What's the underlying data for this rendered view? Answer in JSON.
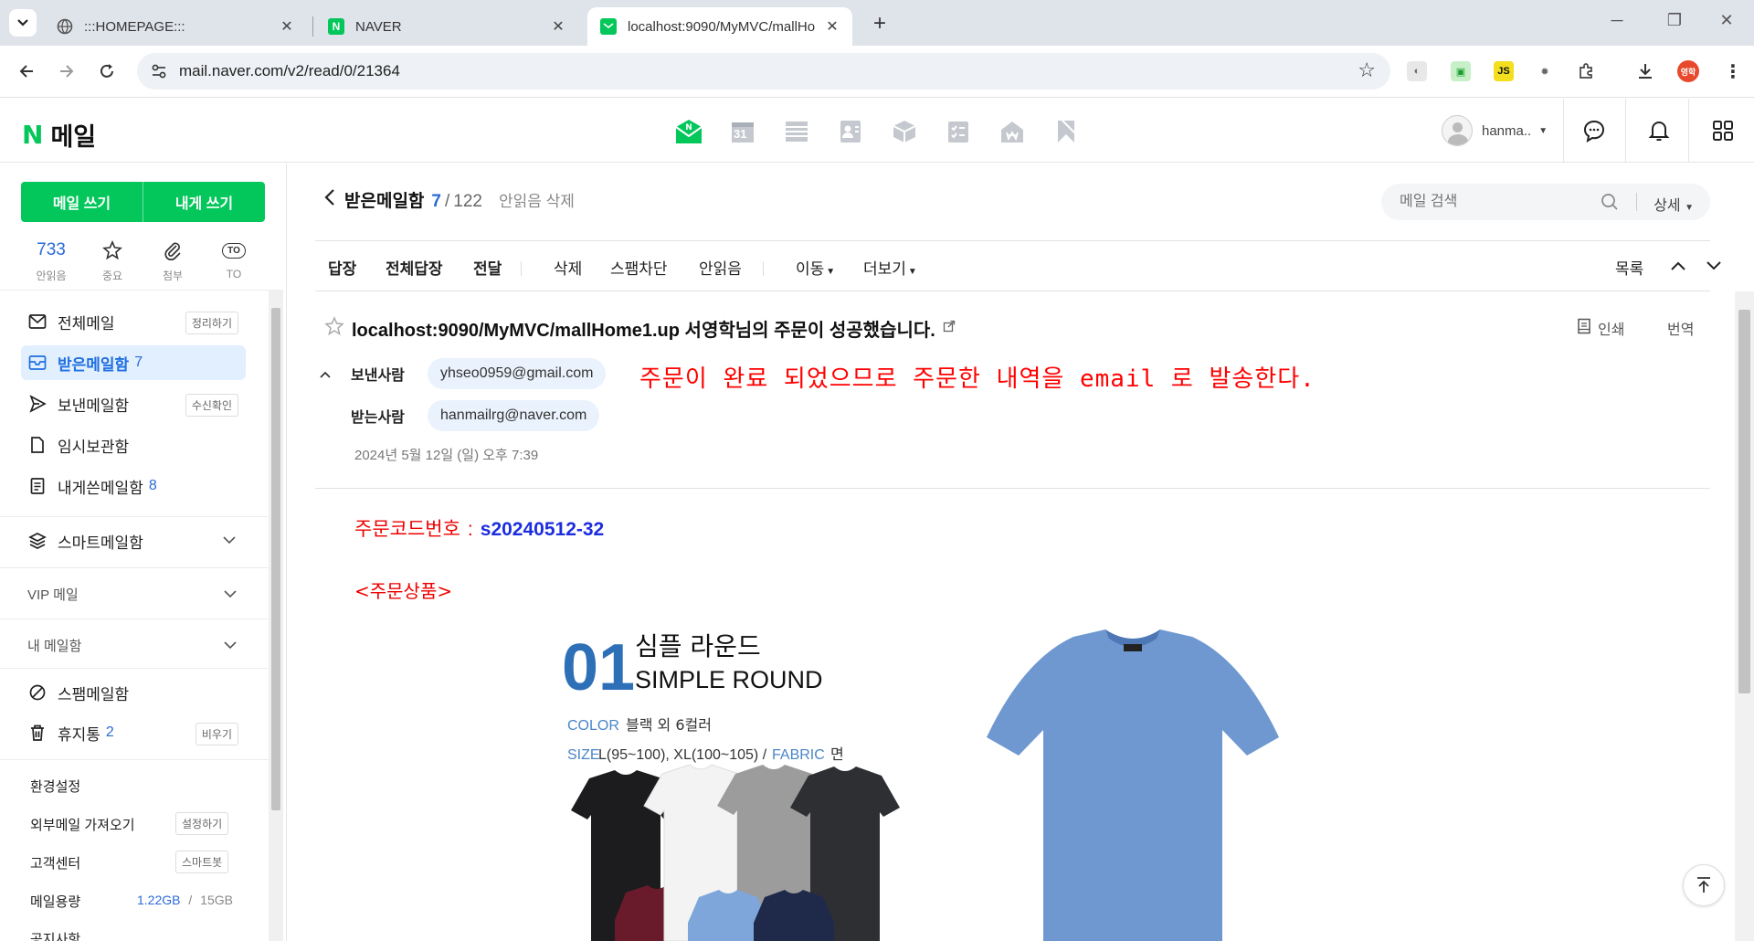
{
  "browser": {
    "tabs": [
      {
        "title": ":::HOMEPAGE:::",
        "icon": "globe-icon"
      },
      {
        "title": "NAVER",
        "icon": "naver-n-icon"
      },
      {
        "title": "localhost:9090/MyMVC/mallHo",
        "icon": "naver-mail-icon"
      }
    ],
    "url": "mail.naver.com/v2/read/0/21364",
    "profile_badge": "영학",
    "ext_js": "JS"
  },
  "app": {
    "logo_letter": "N",
    "logo_text": "메일",
    "user_name": "hanma..",
    "calendar_day": "31"
  },
  "sidebar": {
    "write_btn": "메일 쓰기",
    "self_write_btn": "내게 쓰기",
    "quick": [
      {
        "value": "733",
        "label": "안읽음"
      },
      {
        "label": "중요"
      },
      {
        "label": "첨부"
      },
      {
        "label": "TO",
        "badge": "TO"
      }
    ],
    "folders": [
      {
        "label": "전체메일",
        "action": "정리하기"
      },
      {
        "label": "받은메일함",
        "count": "7"
      },
      {
        "label": "보낸메일함",
        "action": "수신확인"
      },
      {
        "label": "임시보관함"
      },
      {
        "label": "내게쓴메일함",
        "count": "8"
      }
    ],
    "smart": "스마트메일함",
    "vip": "VIP 메일",
    "my": "내 메일함",
    "spam": "스팸메일함",
    "trash": {
      "label": "휴지통",
      "count": "2",
      "action": "비우기"
    },
    "settings": "환경설정",
    "external": {
      "label": "외부메일 가져오기",
      "action": "설정하기"
    },
    "support": {
      "label": "고객센터",
      "action": "스마트봇"
    },
    "quota": {
      "label": "메일용량",
      "used": "1.22GB",
      "sep": "/",
      "total": "15GB"
    },
    "notice": "공지사항"
  },
  "main": {
    "folder_title": "받은메일함",
    "unread": "7",
    "slash": "/",
    "total": "122",
    "delete_unread": "안읽음 삭제",
    "search_placeholder": "메일 검색",
    "search_detail": "상세",
    "toolbar": {
      "reply": "답장",
      "reply_all": "전체답장",
      "forward": "전달",
      "delete": "삭제",
      "spam_block": "스팸차단",
      "mark_unread": "안읽음",
      "move": "이동",
      "more": "더보기",
      "list": "목록"
    },
    "print": "인쇄",
    "translate": "번역",
    "subject": "localhost:9090/MyMVC/mallHome1.up 서영학님의 주문이 성공했습니다.",
    "from_label": "보낸사람",
    "from": "yhseo0959@gmail.com",
    "to_label": "받는사람",
    "to": "hanmailrg@naver.com",
    "date": "2024년 5월 12일 (일) 오후 7:39",
    "annotation": "주문이 완료 되었으므로 주문한 내역을 email 로 발송한다.",
    "body": {
      "order_code_label": "주문코드번호",
      "colon": ":",
      "order_code": "s20240512-32",
      "products_title": "<주문상품>",
      "product_ad": {
        "number": "01",
        "name_kr": "심플 라운드",
        "name_en": "SIMPLE ROUND",
        "color_label": "COLOR",
        "color_value": "블랙 외 6컬러",
        "size_label": "SIZE",
        "size_value": "L(95~100), XL(100~105) /",
        "fabric_label": "FABRIC",
        "fabric_value": "면"
      }
    }
  },
  "colors": {
    "naver_green": "#03c75a",
    "link_blue": "#2a6ad8",
    "annotation_red": "#ff0000",
    "order_code_blue": "#1c2de0",
    "selected_bg": "#e2efff"
  }
}
